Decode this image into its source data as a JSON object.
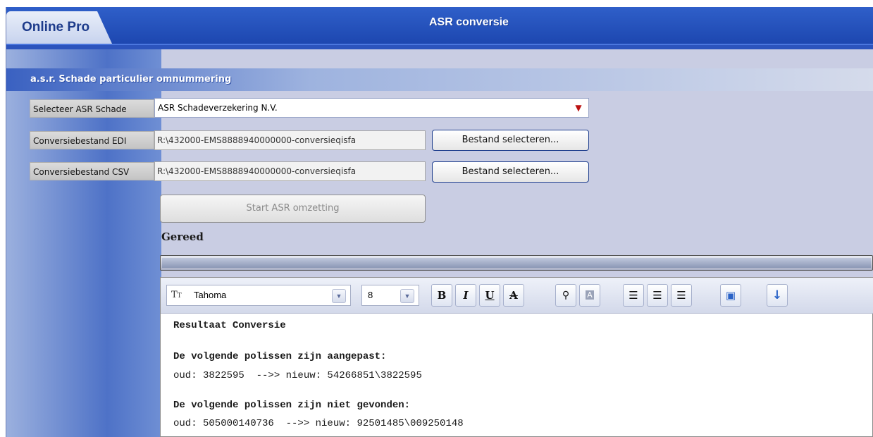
{
  "app": {
    "tab_label": "Online Pro",
    "window_title": "ASR conversie"
  },
  "section": {
    "title": "a.s.r. Schade particulier omnummering"
  },
  "form": {
    "select_label": "Selecteer ASR Schade",
    "select_value": "ASR Schadeverzekering N.V.",
    "edi_label": "Conversiebestand EDI",
    "edi_value": "R:\\432000-EMS8888940000000-conversieqisfa",
    "edi_button": "Bestand selecteren...",
    "csv_label": "Conversiebestand CSV",
    "csv_value": "R:\\432000-EMS8888940000000-conversieqisfa",
    "csv_button": "Bestand selecteren...",
    "start_button": "Start ASR omzetting"
  },
  "status": {
    "text": "Gereed",
    "progress_fraction": 1.0
  },
  "editor": {
    "font_name": "Tahoma",
    "font_size": "8",
    "toolbar_icons": [
      "font-type-icon",
      "bold-icon",
      "italic-icon",
      "underline-icon",
      "strikethrough-icon",
      "find-icon",
      "highlight-icon",
      "align-left-icon",
      "align-center-icon",
      "align-right-icon",
      "print-icon",
      "download-icon"
    ],
    "lines": {
      "heading": "Resultaat Conversie",
      "adjusted_heading": "De volgende polissen zijn aangepast:",
      "adjusted_row": "oud: 3822595  -->> nieuw: 54266851\\3822595",
      "notfound_heading": "De volgende polissen zijn niet gevonden:",
      "notfound_row": "oud: 505000140736  -->> nieuw: 92501485\\009250148"
    }
  }
}
